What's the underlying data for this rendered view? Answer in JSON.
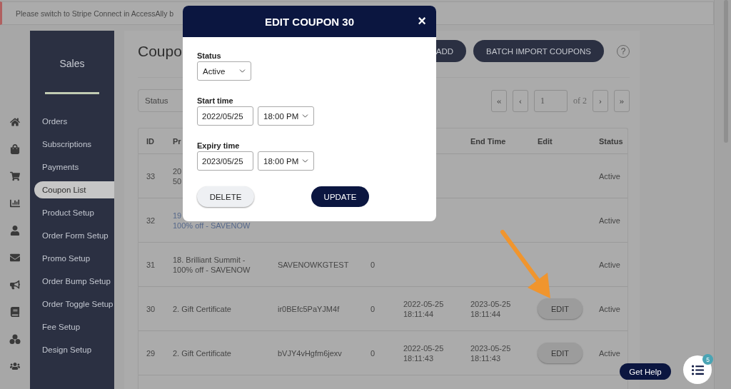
{
  "notice": {
    "text": "Please switch to Stripe Connect in AccessAlly b"
  },
  "sidebar": {
    "title": "Sales",
    "items": [
      {
        "label": "Orders",
        "selected": false
      },
      {
        "label": "Subscriptions",
        "selected": false
      },
      {
        "label": "Payments",
        "selected": false
      },
      {
        "label": "Coupon List",
        "selected": true
      },
      {
        "label": "Product Setup",
        "selected": false
      },
      {
        "label": "Order Form Setup",
        "selected": false
      },
      {
        "label": "Promo Setup",
        "selected": false
      },
      {
        "label": "Order Bump Setup",
        "selected": false
      },
      {
        "label": "Order Toggle Setup",
        "selected": false
      },
      {
        "label": "Fee Setup",
        "selected": false
      },
      {
        "label": "Design Setup",
        "selected": false
      }
    ]
  },
  "page": {
    "title": "Coupo",
    "add_button": "ADD",
    "import_button": "BATCH IMPORT COUPONS",
    "help": "?"
  },
  "status_filter": {
    "value": "Status"
  },
  "pagination": {
    "first": "«",
    "prev": "‹",
    "page": "1",
    "total": "of 2",
    "next": "›",
    "last": "»"
  },
  "table": {
    "headers": {
      "id": "ID",
      "product": "Pr",
      "end_time": "End Time",
      "edit": "Edit",
      "status": "Status"
    },
    "rows": [
      {
        "id": "33",
        "product": [
          "20",
          "50"
        ],
        "product_link": false,
        "status": "Active"
      },
      {
        "id": "32",
        "product": [
          "19",
          "100% off - SAVENOW"
        ],
        "product_link": true,
        "status": "Active"
      },
      {
        "id": "31",
        "product": [
          "18. Brilliant Summit -",
          "100% off - SAVENOW"
        ],
        "product_link": false,
        "code": "SAVENOWKGTEST",
        "uses": "0",
        "status": "Active"
      },
      {
        "id": "30",
        "product": [
          "2. Gift Certificate"
        ],
        "product_link": false,
        "code": "ir0BEfc5PaYJM4f",
        "uses": "0",
        "start_time": [
          "2022-05-25",
          "18:11:44"
        ],
        "end_time": [
          "2023-05-25",
          "18:11:44"
        ],
        "edit": "EDIT",
        "status": "Active"
      },
      {
        "id": "29",
        "product": [
          "2. Gift Certificate"
        ],
        "product_link": false,
        "code": "bVJY4vHgfm6jexv",
        "uses": "0",
        "start_time": [
          "2022-05-25",
          "18:11:43"
        ],
        "end_time": [
          "2023-05-25",
          "18:11:43"
        ],
        "edit": "EDIT",
        "status": "Active"
      }
    ]
  },
  "modal": {
    "title": "EDIT COUPON 30",
    "close": "×",
    "fields": [
      {
        "kind": "select",
        "label": "Status",
        "value": "Active"
      },
      {
        "kind": "datetime",
        "label": "Start time",
        "date": "2022/05/25",
        "time": "18:00 PM"
      },
      {
        "kind": "datetime",
        "label": "Expiry time",
        "date": "2023/05/25",
        "time": "18:00 PM"
      }
    ],
    "delete_button": "DELETE",
    "update_button": "UPDATE"
  },
  "help": {
    "button": "Get Help",
    "badge": "5"
  }
}
